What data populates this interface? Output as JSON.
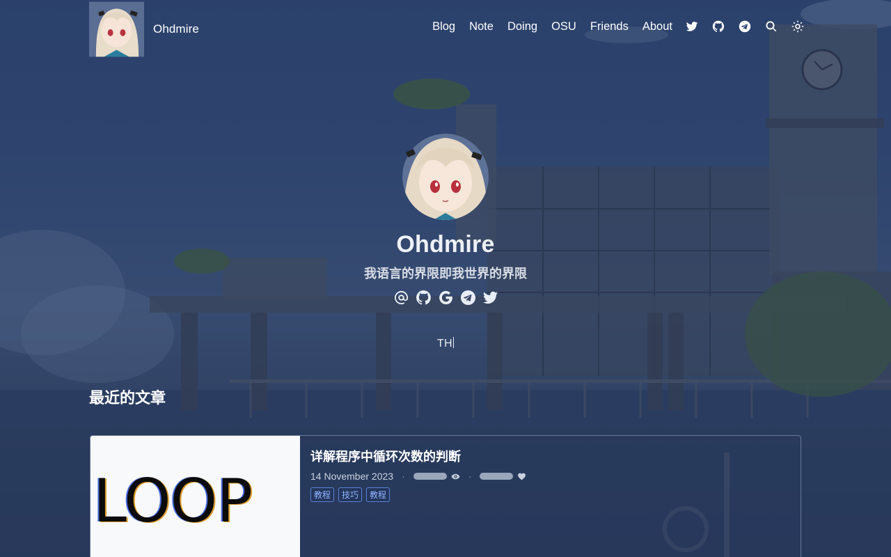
{
  "site": {
    "name": "Ohdmire"
  },
  "nav": {
    "items": [
      {
        "label": "Blog"
      },
      {
        "label": "Note"
      },
      {
        "label": "Doing"
      },
      {
        "label": "OSU"
      },
      {
        "label": "Friends"
      },
      {
        "label": "About"
      }
    ],
    "icons": [
      "twitter-icon",
      "github-icon",
      "telegram-icon",
      "search-icon",
      "theme-toggle-icon"
    ]
  },
  "hero": {
    "name": "Ohdmire",
    "bio": "我语言的界限即我世界的界限",
    "social_icons": [
      "email-at-icon",
      "github-icon",
      "google-icon",
      "telegram-icon",
      "twitter-icon"
    ],
    "typed_text": "TH"
  },
  "recent": {
    "title": "最近的文章",
    "posts": [
      {
        "cover_text": "LOOP",
        "title": "详解程序中循环次数的判断",
        "date": "14 November 2023",
        "tags": [
          "教程",
          "技巧",
          "教程"
        ]
      }
    ]
  },
  "colors": {
    "background": "#2c3f63",
    "tag_accent": "#8fb4ff"
  }
}
